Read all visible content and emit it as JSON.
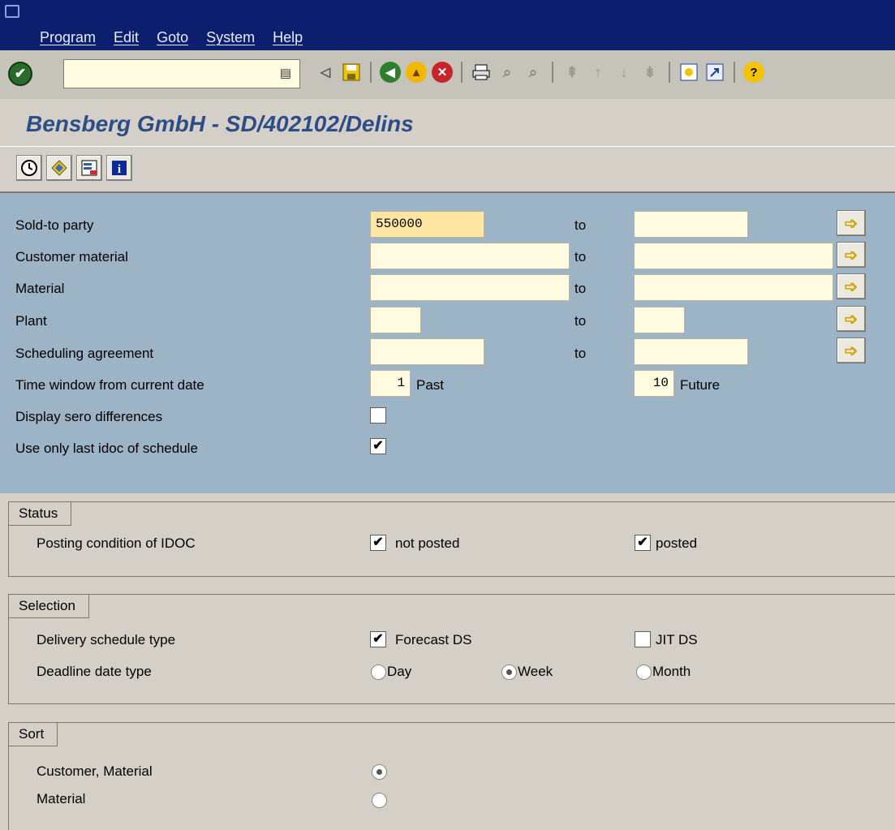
{
  "menu": {
    "items": [
      "Program",
      "Edit",
      "Goto",
      "System",
      "Help"
    ]
  },
  "toolbar": {
    "command_value": "",
    "icons": [
      "enter-icon",
      "back-arrow-icon",
      "save-icon",
      "back-icon",
      "exit-icon",
      "cancel-icon",
      "print-icon",
      "find-icon",
      "find-next-icon",
      "first-page-icon",
      "prev-page-icon",
      "next-page-icon",
      "last-page-icon",
      "new-session-icon",
      "shortcut-icon",
      "help-icon"
    ]
  },
  "title": "Bensberg GmbH - SD/402102/Delins",
  "app_toolbar": {
    "buttons": [
      "execute-icon",
      "variant-icon",
      "selection-options-icon",
      "info-icon"
    ]
  },
  "selection": {
    "to_label": "to",
    "rows": [
      {
        "label": "Sold-to party",
        "low": "550000",
        "high": ""
      },
      {
        "label": "Customer material",
        "low": "",
        "high": ""
      },
      {
        "label": "Material",
        "low": "",
        "high": ""
      },
      {
        "label": "Plant",
        "low": "",
        "high": ""
      },
      {
        "label": "Scheduling agreement",
        "low": "",
        "high": ""
      }
    ],
    "time_window": {
      "label": "Time window from current date",
      "past_value": "1",
      "past_label": "Past",
      "future_value": "10",
      "future_label": "Future"
    },
    "zero_diff": {
      "label": "Display sero differences",
      "checked": false
    },
    "last_idoc": {
      "label": "Use only last idoc of schedule",
      "checked": true
    }
  },
  "status_group": {
    "title": "Status",
    "posting_label": "Posting condition of IDOC",
    "not_posted_label": "not posted",
    "posted_label": "posted",
    "not_posted_checked": true,
    "posted_checked": true
  },
  "selection_group": {
    "title": "Selection",
    "schedule_type_label": "Delivery schedule type",
    "forecast_label": "Forecast DS",
    "forecast_checked": true,
    "jit_label": "JIT DS",
    "jit_checked": false,
    "deadline_label": "Deadline date type",
    "day_label": "Day",
    "week_label": "Week",
    "month_label": "Month",
    "selected_deadline": "Week"
  },
  "sort_group": {
    "title": "Sort",
    "option1_label": "Customer, Material",
    "option2_label": "Material",
    "selected": "Customer, Material"
  }
}
